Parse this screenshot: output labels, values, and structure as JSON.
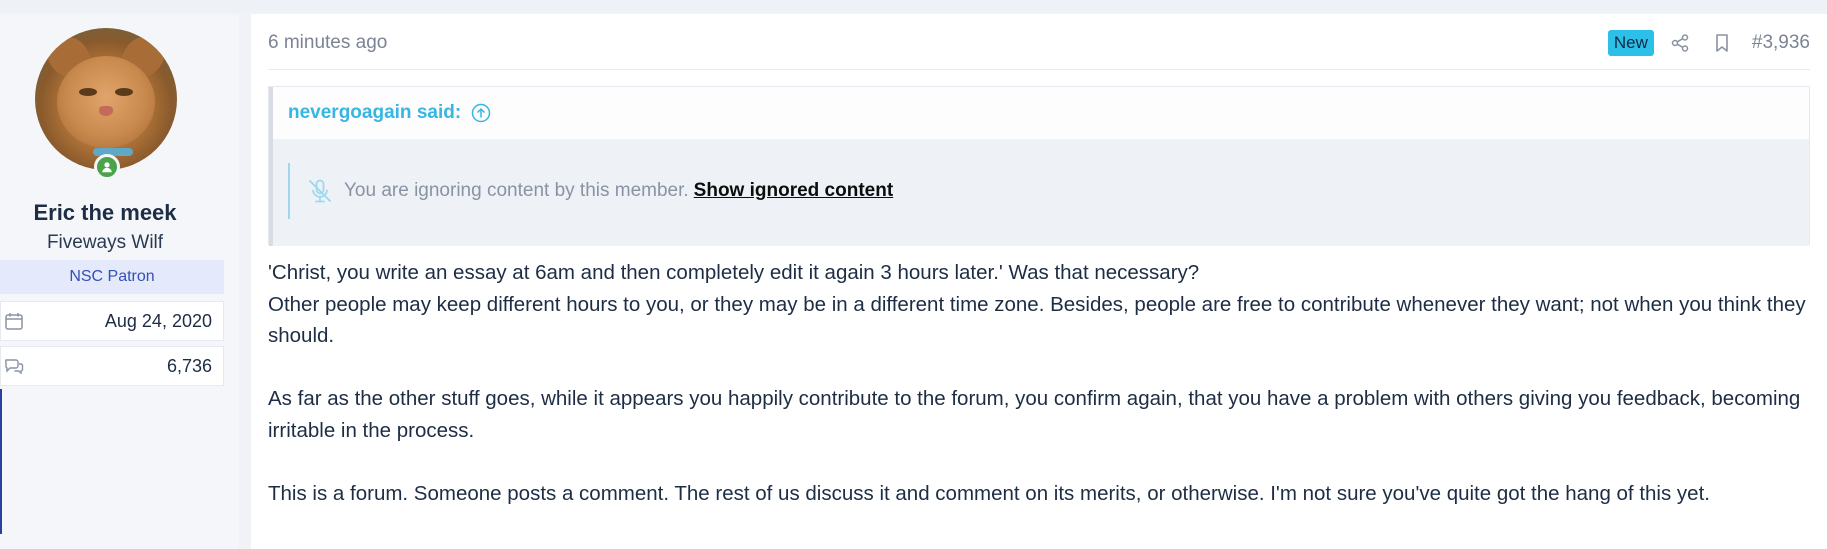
{
  "user": {
    "name": "Eric the meek",
    "title": "Fiveways Wilf",
    "banner": "NSC Patron",
    "joined": "Aug 24, 2020",
    "messages": "6,736",
    "status_color": "#4ba34a"
  },
  "post": {
    "time": "6 minutes ago",
    "badge": "New",
    "number": "#3,936",
    "icons": [
      "share-icon",
      "bookmark-icon"
    ]
  },
  "quote": {
    "author": "nevergoagain said:",
    "ignored_text": "You are ignoring content by this member.",
    "show_link": "Show ignored content"
  },
  "message": {
    "p1_line1": "'Christ, you write an essay at 6am and then completely edit it again 3 hours later.' Was that necessary?",
    "p1_line2": "Other people may keep different hours to you, or they may be in a different time zone. Besides, people are free to contribute whenever they want; not when you think they should.",
    "p2": "As far as the other stuff goes, while it appears you happily contribute to the forum, you confirm again, that you have a problem with others giving you feedback, becoming irritable in the process.",
    "p3": "This is a forum. Someone posts a comment. The rest of us discuss it and comment on its merits, or otherwise. I'm not sure you've quite got the hang of this yet."
  },
  "colors": {
    "accent": "#35b6e3",
    "badge_bg": "#2cc0e8",
    "banner_bg": "#e4e9fb",
    "banner_text": "#3450b4"
  }
}
